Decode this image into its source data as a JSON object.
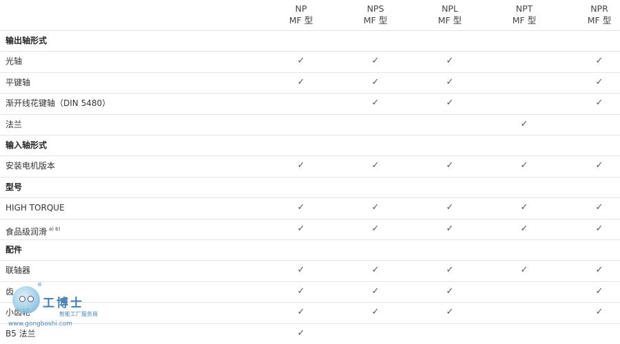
{
  "columns": [
    {
      "line1": "NP",
      "line2": "MF 型"
    },
    {
      "line1": "NPS",
      "line2": "MF 型"
    },
    {
      "line1": "NPL",
      "line2": "MF 型"
    },
    {
      "line1": "NPT",
      "line2": "MF 型"
    },
    {
      "line1": "NPR",
      "line2": "MF 型"
    }
  ],
  "check_glyph": "✓",
  "rows": [
    {
      "label": "输出轴形式",
      "section": true,
      "checks": [
        false,
        false,
        false,
        false,
        false
      ]
    },
    {
      "label": "光轴",
      "section": false,
      "checks": [
        true,
        true,
        true,
        false,
        true
      ]
    },
    {
      "label": "平键轴",
      "section": false,
      "checks": [
        true,
        true,
        true,
        false,
        true
      ]
    },
    {
      "label": "渐开线花键轴（DIN 5480）",
      "section": false,
      "checks": [
        false,
        true,
        true,
        false,
        true
      ]
    },
    {
      "label": "法兰",
      "section": false,
      "checks": [
        false,
        false,
        false,
        true,
        false
      ]
    },
    {
      "label": "输入轴形式",
      "section": true,
      "checks": [
        false,
        false,
        false,
        false,
        false
      ]
    },
    {
      "label": "安装电机版本",
      "section": false,
      "checks": [
        true,
        true,
        true,
        true,
        true
      ]
    },
    {
      "label": "型号",
      "section": true,
      "checks": [
        false,
        false,
        false,
        false,
        false
      ]
    },
    {
      "label": "HIGH TORQUE",
      "section": false,
      "checks": [
        true,
        true,
        true,
        true,
        true
      ]
    },
    {
      "label": "食品级润滑",
      "note": "a) b)",
      "section": false,
      "checks": [
        true,
        true,
        true,
        true,
        true
      ]
    },
    {
      "label": "配件",
      "section": true,
      "checks": [
        false,
        false,
        false,
        false,
        false
      ]
    },
    {
      "label": "联轴器",
      "section": false,
      "checks": [
        true,
        true,
        true,
        true,
        true
      ]
    },
    {
      "label": "齿",
      "section": false,
      "checks": [
        true,
        true,
        true,
        false,
        true
      ]
    },
    {
      "label": "小齿轮",
      "section": false,
      "checks": [
        true,
        true,
        true,
        false,
        true
      ]
    },
    {
      "label": "B5 法兰",
      "section": false,
      "checks": [
        true,
        false,
        false,
        false,
        false
      ]
    }
  ],
  "watermark": {
    "name": "工博士",
    "reg": "®",
    "subtitle": "智能工厂服务商",
    "url": "www.gongboshi.com"
  }
}
